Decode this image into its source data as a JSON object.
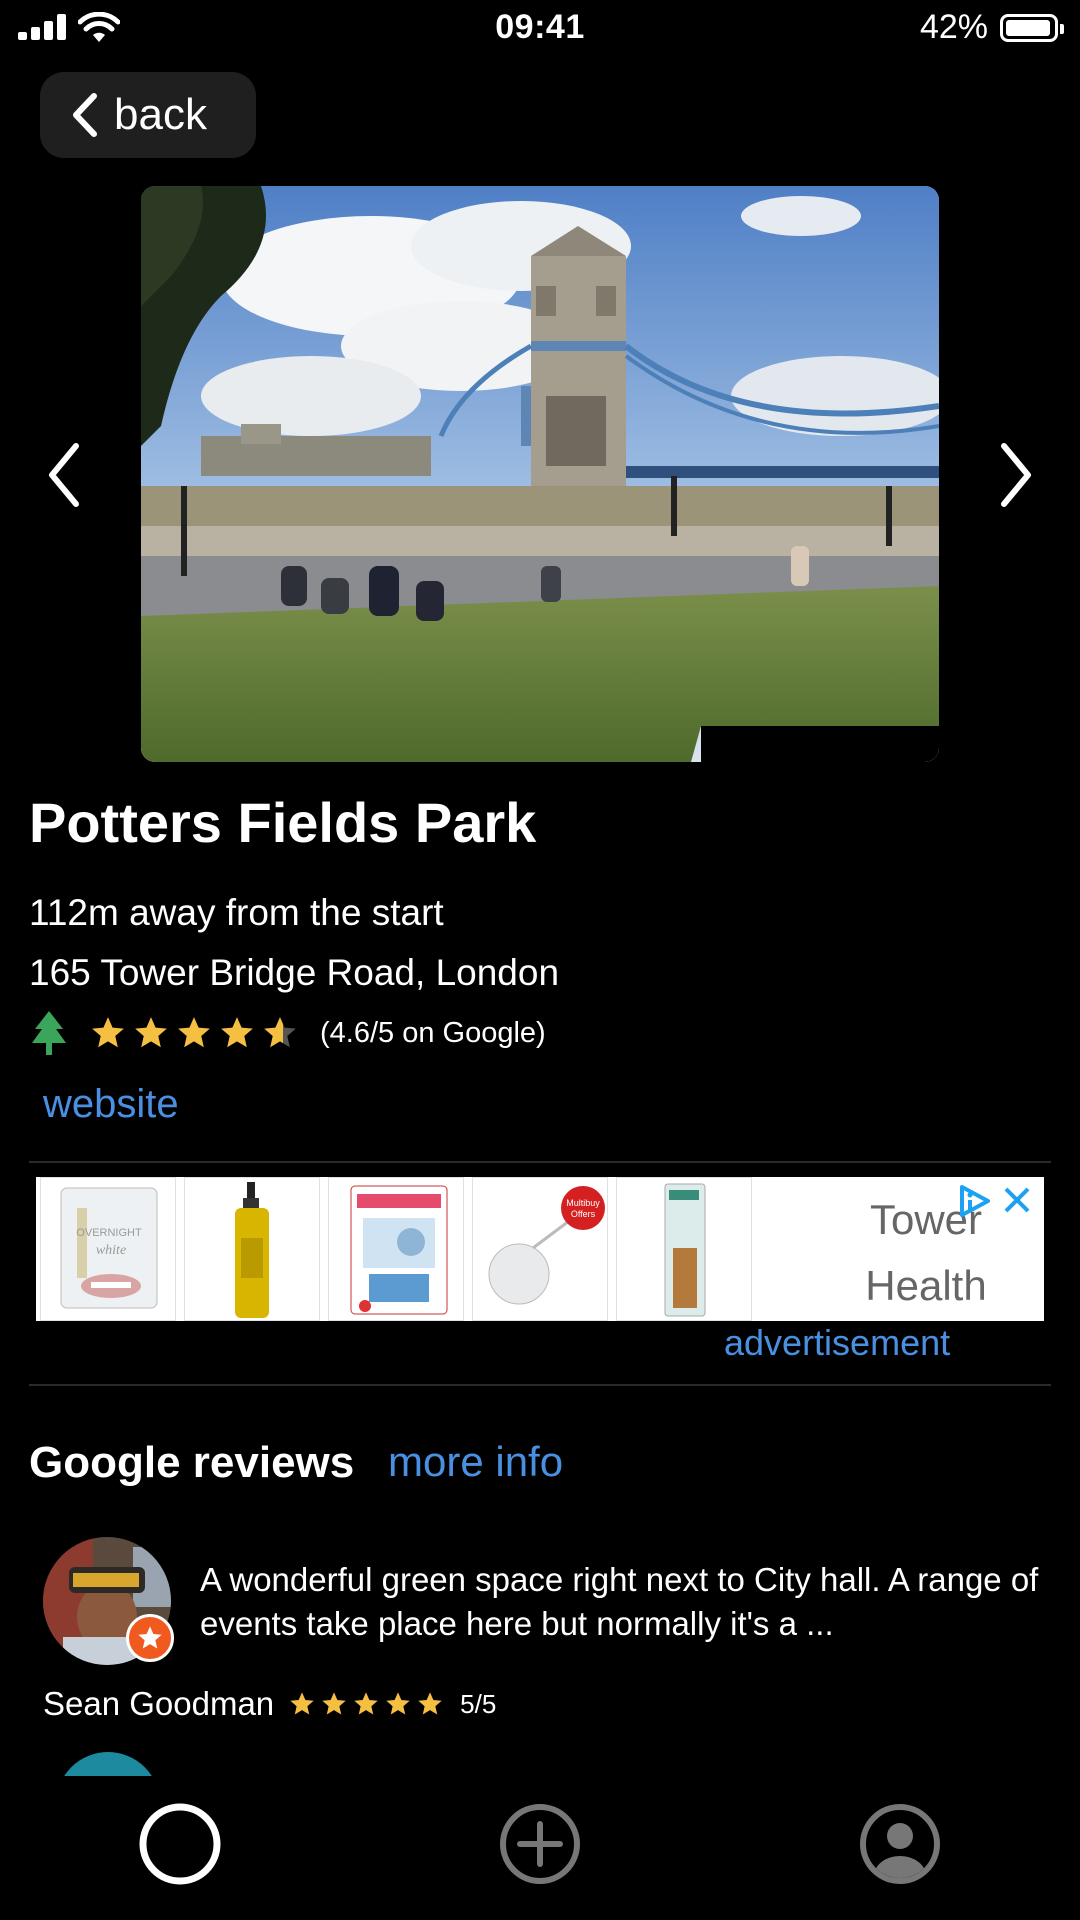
{
  "status_bar": {
    "time": "09:41",
    "battery": "42%"
  },
  "nav": {
    "back_label": "back"
  },
  "place": {
    "title": "Potters Fields Park",
    "distance": "112m away from the start",
    "address": "165 Tower Bridge Road, London",
    "rating_value": 4.6,
    "rating_text": "(4.6/5 on Google)",
    "website_label": "website"
  },
  "ad": {
    "brand_line1": "Tower",
    "brand_line2": "Health",
    "label": "advertisement",
    "tile4_badge_line1": "Multibuy",
    "tile4_badge_line2": "Offers",
    "tile1_text_line1": "OVERNIGHT",
    "tile1_text_line2": "white"
  },
  "reviews": {
    "heading": "Google reviews",
    "more_info_label": "more info",
    "items": [
      {
        "text": "A wonderful green space right next to City hall. A range of events take place here but normally it's a ...",
        "author": "Sean Goodman",
        "score": "5/5",
        "rating_value": 5
      }
    ]
  },
  "colors": {
    "background": "#000000",
    "link": "#4a90e2",
    "star": "#f5c042",
    "tree": "#3ca55c"
  },
  "icons": {
    "tab_home": "circle-icon",
    "tab_add": "plus-circle-icon",
    "tab_profile": "profile-icon"
  }
}
